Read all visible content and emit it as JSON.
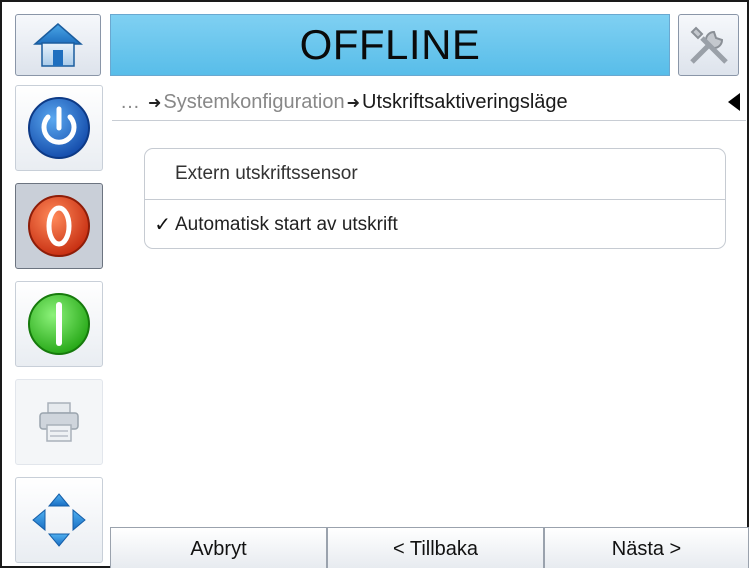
{
  "header": {
    "status_text": "OFFLINE",
    "home_icon": "home-icon",
    "tools_icon": "tools-icon"
  },
  "sidebar": {
    "items": [
      {
        "name": "power",
        "icon": "power-icon",
        "color": "#1a5fc7"
      },
      {
        "name": "stop",
        "icon": "stop-icon",
        "color": "#e0441a",
        "pressed": true
      },
      {
        "name": "start",
        "icon": "start-icon",
        "color": "#3cc829"
      },
      {
        "name": "print",
        "icon": "printer-icon",
        "color": "#9aa4ad"
      },
      {
        "name": "navigate",
        "icon": "navigate-icon",
        "color": "#2a93d8"
      }
    ]
  },
  "breadcrumb": {
    "ellipsis": "…",
    "parent": "Systemkonfiguration",
    "current": "Utskriftsaktiveringsläge",
    "back_icon": "back-arrow-icon"
  },
  "options": [
    {
      "label": "Extern utskriftssensor",
      "checked": false,
      "check_mark": ""
    },
    {
      "label": "Automatisk start av utskrift",
      "checked": true,
      "check_mark": "✓"
    }
  ],
  "footer": {
    "cancel_label": "Avbryt",
    "back_label": "< Tillbaka",
    "next_label": "Nästa >"
  },
  "colors": {
    "status_bar": "#6cc7ee",
    "accent_blue": "#1a5fc7",
    "stop_red": "#e0441a",
    "start_green": "#3cc829"
  }
}
